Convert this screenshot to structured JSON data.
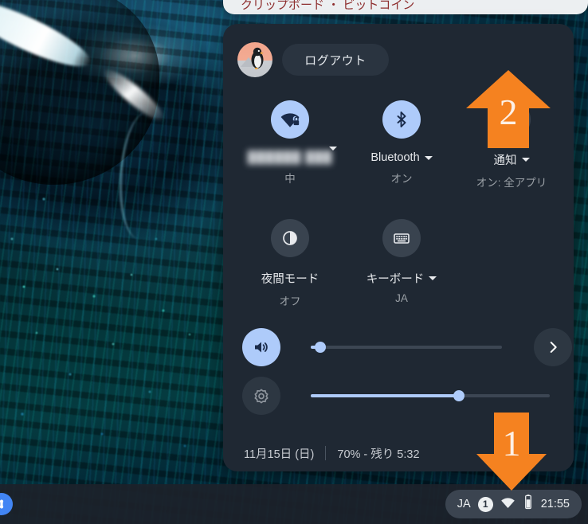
{
  "wallpaper": {
    "description": "macro water droplet on iridescent blue-teal fabric"
  },
  "top_window": {
    "clipped_text": "クリップボード ・ ビットコイン"
  },
  "tray": {
    "user": {
      "avatar_icon": "penguin-avatar"
    },
    "logout_label": "ログアウト",
    "power_icon": "power-icon",
    "lock_icon": "lock-icon",
    "settings_icon": "gear-icon",
    "collapse_icon": "chevron-down-icon",
    "tiles": [
      {
        "id": "network",
        "icon": "wifi-locked-icon",
        "label": "",
        "label_blurred": "██████ ███",
        "sub": "中",
        "state": "on",
        "has_caret": true
      },
      {
        "id": "bluetooth",
        "icon": "bluetooth-icon",
        "label": "Bluetooth",
        "sub": "オン",
        "state": "on",
        "has_caret": true
      },
      {
        "id": "notifications",
        "icon": "do-not-disturb-icon",
        "label": "通知",
        "sub": "オン: 全アプリ",
        "state": "off",
        "has_caret": true
      },
      {
        "id": "night-light",
        "icon": "moon-icon",
        "label": "夜間モード",
        "sub": "オフ",
        "state": "off",
        "has_caret": false
      },
      {
        "id": "keyboard",
        "icon": "keyboard-icon",
        "label": "キーボード",
        "sub": "JA",
        "state": "off",
        "has_caret": true
      }
    ],
    "sliders": [
      {
        "id": "volume",
        "icon": "volume-icon",
        "value": 5,
        "state": "on",
        "next_icon": "chevron-right-icon"
      },
      {
        "id": "brightness",
        "icon": "brightness-icon",
        "value": 62,
        "state": "off"
      }
    ],
    "footer": {
      "date": "11月15日 (日)",
      "battery": "70% - 残り 5:32"
    }
  },
  "shelf": {
    "launcher_icon": "launcher-icon",
    "status": {
      "ime": "JA",
      "notification_count": "1",
      "wifi_icon": "wifi-icon",
      "battery_icon": "battery-icon",
      "time": "21:55"
    }
  },
  "annotations": [
    {
      "id": "arrow-1",
      "number": "1",
      "direction": "down",
      "color": "#f58220",
      "target": "status-tray"
    },
    {
      "id": "arrow-2",
      "number": "2",
      "direction": "up",
      "color": "#f58220",
      "target": "settings-button"
    }
  ]
}
